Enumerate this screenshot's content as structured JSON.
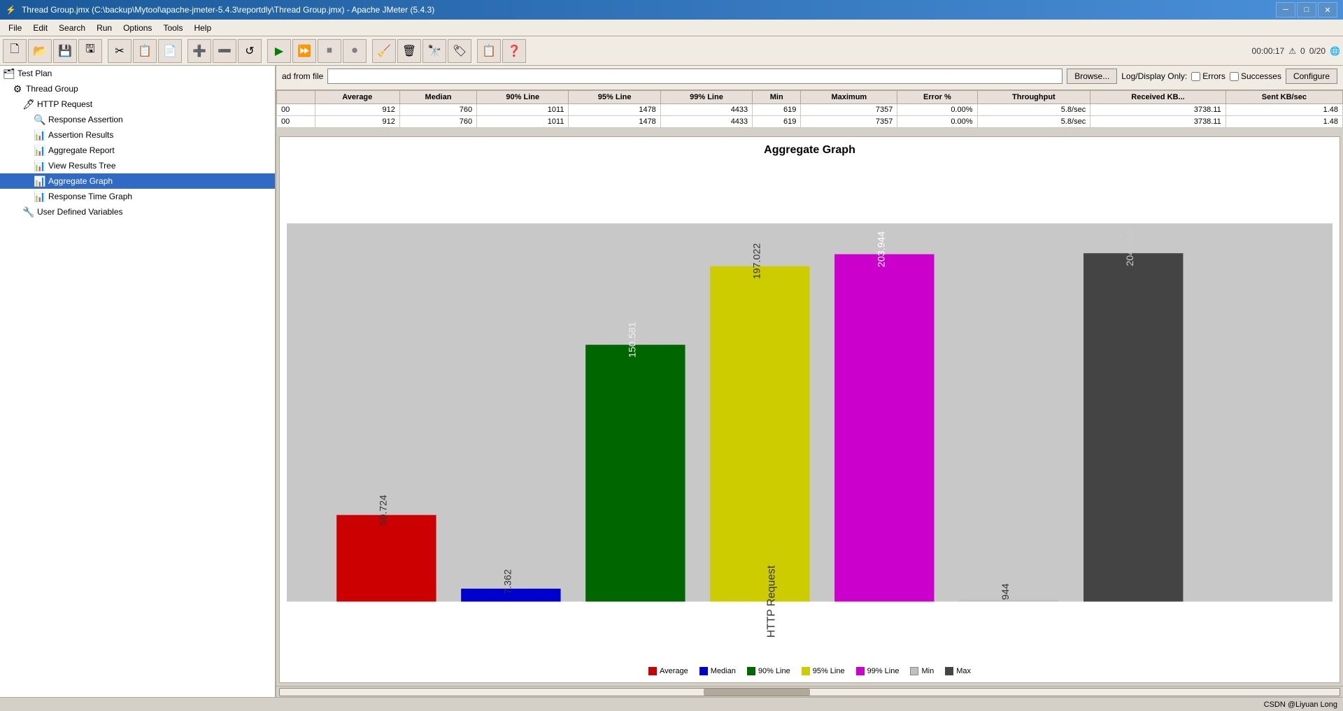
{
  "window": {
    "title": "Thread Group.jmx (C:\\backup\\Mytool\\apache-jmeter-5.4.3\\reportdly\\Thread Group.jmx) - Apache JMeter (5.4.3)"
  },
  "menu": {
    "items": [
      "File",
      "Edit",
      "Search",
      "Run",
      "Options",
      "Tools",
      "Help"
    ]
  },
  "toolbar": {
    "timer": "00:00:17",
    "warnings": "0",
    "threads": "0/20"
  },
  "tree": {
    "items": [
      {
        "id": "test-plan",
        "label": "Test Plan",
        "level": 0,
        "icon": "🗂",
        "selected": false
      },
      {
        "id": "thread-group",
        "label": "Thread Group",
        "level": 1,
        "icon": "⚙",
        "selected": false
      },
      {
        "id": "http-request",
        "label": "HTTP Request",
        "level": 2,
        "icon": "🖊",
        "selected": false
      },
      {
        "id": "response-assertion",
        "label": "Response Assertion",
        "level": 3,
        "icon": "🔍",
        "selected": false
      },
      {
        "id": "assertion-results",
        "label": "Assertion Results",
        "level": 3,
        "icon": "📊",
        "selected": false
      },
      {
        "id": "aggregate-report",
        "label": "Aggregate Report",
        "level": 3,
        "icon": "📊",
        "selected": false
      },
      {
        "id": "view-results-tree",
        "label": "View Results Tree",
        "level": 3,
        "icon": "📊",
        "selected": false
      },
      {
        "id": "aggregate-graph",
        "label": "Aggregate Graph",
        "level": 3,
        "icon": "📊",
        "selected": true
      },
      {
        "id": "response-time-graph",
        "label": "Response Time Graph",
        "level": 3,
        "icon": "📊",
        "selected": false
      },
      {
        "id": "user-defined-variables",
        "label": "User Defined Variables",
        "level": 2,
        "icon": "🔧",
        "selected": false
      }
    ]
  },
  "controls": {
    "file_placeholder": "",
    "browse_label": "Browse...",
    "log_display_label": "Log/Display Only:",
    "errors_label": "Errors",
    "successes_label": "Successes",
    "configure_label": "Configure"
  },
  "table": {
    "columns": [
      "",
      "Average",
      "Median",
      "90% Line",
      "95% Line",
      "99% Line",
      "Min",
      "Maximum",
      "Error %",
      "Throughput",
      "Received KB...",
      "Sent KB/sec"
    ],
    "rows": [
      {
        "label": "00",
        "average": "912",
        "median": "760",
        "line90": "1011",
        "line95": "1478",
        "line99": "4433",
        "min": "619",
        "max": "7357",
        "error": "0.00%",
        "throughput": "5.8/sec",
        "received": "3738.11",
        "sent": "1.48"
      },
      {
        "label": "00",
        "average": "912",
        "median": "760",
        "line90": "1011",
        "line95": "1478",
        "line99": "4433",
        "min": "619",
        "max": "7357",
        "error": "0.00%",
        "throughput": "5.8/sec",
        "received": "3738.11",
        "sent": "1.48"
      }
    ]
  },
  "chart": {
    "title": "Aggregate Graph",
    "x_label": "HTTP Request",
    "bars": [
      {
        "id": "average",
        "label": "Average",
        "value": 50724,
        "color": "#cc0000",
        "display": "50.724"
      },
      {
        "id": "median",
        "label": "Median",
        "value": 7362,
        "color": "#0000cc",
        "display": "7.362"
      },
      {
        "id": "line90",
        "label": "90% Line",
        "value": 150581,
        "color": "#006600",
        "display": "150.581"
      },
      {
        "id": "line95",
        "label": "95% Line",
        "value": 197022,
        "color": "#cccc00",
        "display": "197.022"
      },
      {
        "id": "line99",
        "label": "99% Line",
        "value": 203944,
        "color": "#cc00cc",
        "display": "203.944"
      },
      {
        "id": "min",
        "label": "Min",
        "value": 944,
        "color": "#c0c0c0",
        "display": "944"
      },
      {
        "id": "max",
        "label": "Max",
        "value": 204364,
        "color": "#444444",
        "display": "204.364"
      }
    ],
    "legend": [
      {
        "label": "Average",
        "color": "#cc0000"
      },
      {
        "label": "Median",
        "color": "#0000cc"
      },
      {
        "label": "90% Line",
        "color": "#006600"
      },
      {
        "label": "95% Line",
        "color": "#cccc00"
      },
      {
        "label": "99% Line",
        "color": "#cc00cc"
      },
      {
        "label": "Min",
        "color": "#c0c0c0"
      },
      {
        "label": "Max",
        "color": "#444444"
      }
    ]
  },
  "status_bar": {
    "text": "CSDN @Liyuan Long"
  }
}
